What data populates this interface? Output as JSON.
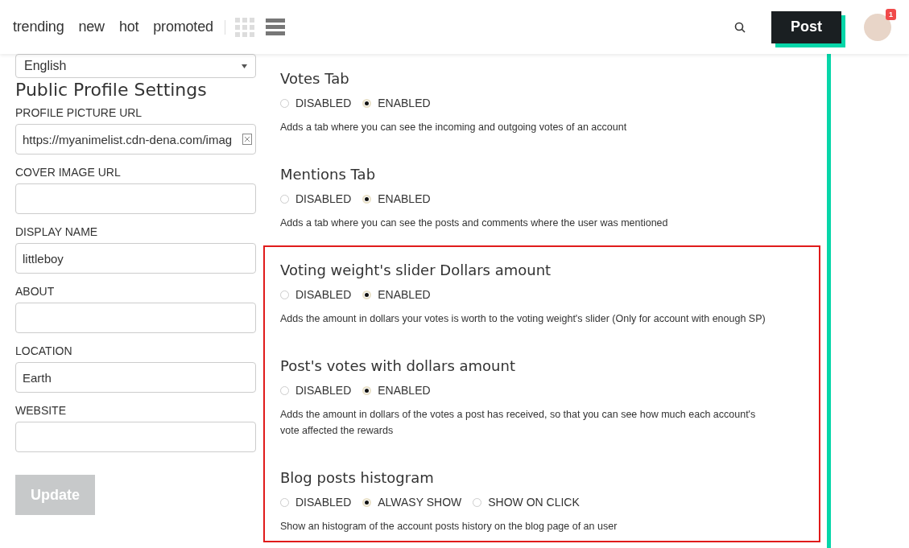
{
  "nav": {
    "links": [
      {
        "label": "trending"
      },
      {
        "label": "new"
      },
      {
        "label": "hot"
      },
      {
        "label": "promoted"
      }
    ],
    "view_modes": [
      {
        "kind": "grid",
        "selected": false
      },
      {
        "kind": "list",
        "selected": true
      }
    ],
    "post_button": "Post",
    "notification_count": "1"
  },
  "profile": {
    "language": "English",
    "title": "Public Profile Settings",
    "fields": [
      {
        "label": "PROFILE PICTURE URL",
        "value": "https://myanimelist.cdn-dena.com/imag",
        "clear_icon": true
      },
      {
        "label": "COVER IMAGE URL"
      },
      {
        "label": "DISPLAY NAME",
        "value": "littleboy"
      },
      {
        "label": "ABOUT"
      },
      {
        "label": "LOCATION",
        "value": "Earth"
      },
      {
        "label": "WEBSITE"
      }
    ],
    "update_button": {
      "label": "Update",
      "disabled": true
    }
  },
  "settings": [
    {
      "title": "Votes Tab",
      "options": [
        {
          "label": "DISABLED",
          "selected": false
        },
        {
          "label": "ENABLED",
          "selected": true
        }
      ],
      "description": "Adds a tab where you can see the incoming and outgoing votes of an account"
    },
    {
      "title": "Mentions Tab",
      "options": [
        {
          "label": "DISABLED",
          "selected": false
        },
        {
          "label": "ENABLED",
          "selected": true
        }
      ],
      "description": "Adds a tab where you can see the posts and comments where the user was mentioned"
    }
  ],
  "highlighted_settings": [
    {
      "title": "Voting weight's slider Dollars amount",
      "options": [
        {
          "label": "DISABLED",
          "selected": false
        },
        {
          "label": "ENABLED",
          "selected": true
        }
      ],
      "description": "Adds the amount in dollars your votes is worth to the voting weight's slider (Only for account with enough SP)"
    },
    {
      "title": "Post's votes with dollars amount",
      "options": [
        {
          "label": "DISABLED",
          "selected": false
        },
        {
          "label": "ENABLED",
          "selected": true
        }
      ],
      "description": "Adds the amount in dollars of the votes a post has received, so that you can see how much each account's vote affected the rewards"
    },
    {
      "title": "Blog posts histogram",
      "options": [
        {
          "label": "DISABLED",
          "selected": false
        },
        {
          "label": "ALWASY SHOW",
          "selected": true
        },
        {
          "label": "SHOW ON CLICK",
          "selected": false
        }
      ],
      "description": "Show an histogram of the account posts history on the blog page of an user"
    }
  ]
}
